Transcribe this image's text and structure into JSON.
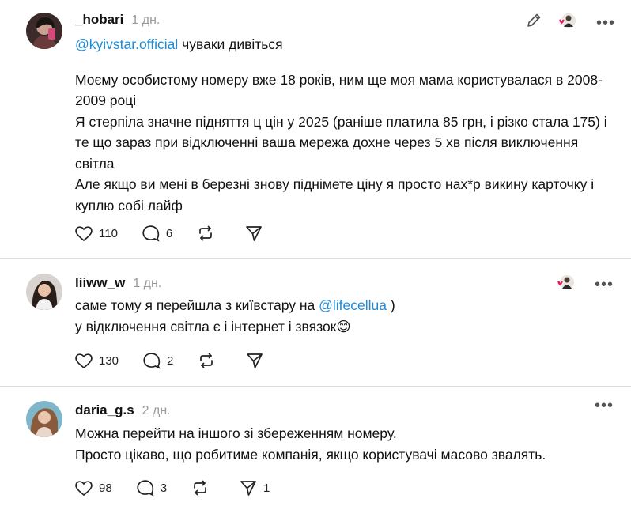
{
  "posts": [
    {
      "username": "_hobari",
      "time": "1 дн.",
      "mention": "@kyivstar.official",
      "first_line_rest": " чуваки дивіться",
      "paragraphs": [
        "Моєму особистому номеру вже 18 років, ним ще моя мама користувалася в 2008-2009 році",
        "Я стерпіла значне підняття ц цін у 2025 (раніше платила 85 грн, і різко стала 175) і те що зараз при відключенні ваша мережа дохне через 5 хв після виключення світла",
        "Але якщо ви мені в березні знову піднімете ціну я просто нах*р викину карточку і куплю собі лайф"
      ],
      "likes": "110",
      "replies": "6",
      "reposts": "",
      "shares": ""
    },
    {
      "username": "liiww_w",
      "time": "1 дн.",
      "line1_prefix": "саме тому я перейшла з київстару на ",
      "mention": "@lifecellua",
      "line1_suffix": " )",
      "line2": "у відключення світла є і інтернет і звязок😊",
      "likes": "130",
      "replies": "2",
      "reposts": "",
      "shares": ""
    },
    {
      "username": "daria_g.s",
      "time": "2 дн.",
      "lines": [
        "Можна перейти на іншого зі збереженням номеру.",
        "Просто цікаво, що робитиме компанія, якщо користувачі масово звалять."
      ],
      "likes": "98",
      "replies": "3",
      "reposts": "",
      "shares": "1"
    }
  ],
  "icons": {
    "edit": "pencil-icon",
    "liked_by_author": "liked-by-author-avatar-icon",
    "more": "more-icon",
    "like": "heart-icon",
    "reply": "comment-icon",
    "repost": "repost-icon",
    "share": "share-icon"
  },
  "colors": {
    "mention": "#1f8ad6",
    "time": "#9a9a9a",
    "heart_badge": "#e0245e",
    "divider": "#dcdcdc"
  }
}
